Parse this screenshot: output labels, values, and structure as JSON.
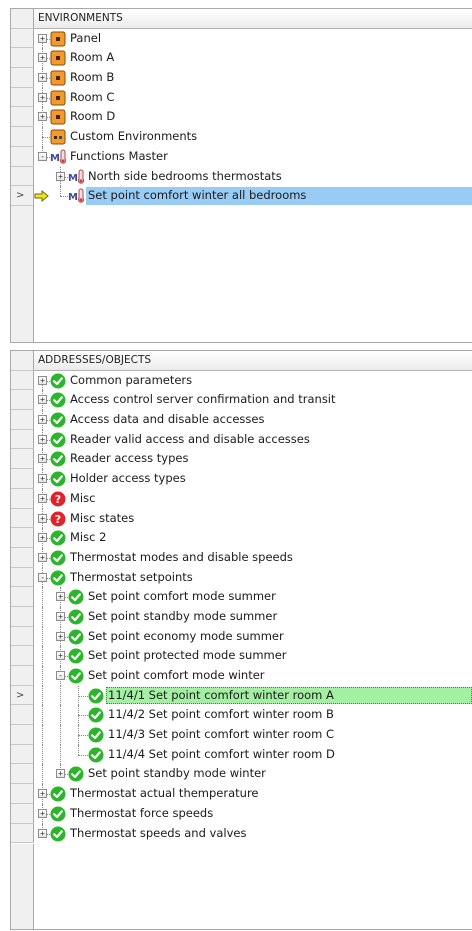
{
  "environments": {
    "header": "ENVIRONMENTS",
    "items": [
      {
        "label": "Panel",
        "icon": "room-icon",
        "expander": "+"
      },
      {
        "label": "Room A",
        "icon": "room-icon",
        "expander": "+"
      },
      {
        "label": "Room B",
        "icon": "room-icon",
        "expander": "+"
      },
      {
        "label": "Room C",
        "icon": "room-icon",
        "expander": "+"
      },
      {
        "label": "Room D",
        "icon": "room-icon",
        "expander": "+"
      },
      {
        "label": "Custom Environments",
        "icon": "custom-environment-icon",
        "expander": ""
      },
      {
        "label": "Functions Master",
        "icon": "functions-master-icon",
        "expander": "-"
      },
      {
        "label": "North side bedrooms thermostats",
        "icon": "function-icon",
        "expander": "+"
      },
      {
        "label": "Set point comfort winter all bedrooms",
        "icon": "function-icon",
        "expander": "",
        "selected": true
      }
    ]
  },
  "objects": {
    "header": "ADDRESSES/OBJECTS",
    "items": [
      {
        "label": "Common parameters",
        "status": "ok"
      },
      {
        "label": "Access control server confirmation and transit",
        "status": "ok"
      },
      {
        "label": "Access data and disable accesses",
        "status": "ok"
      },
      {
        "label": "Reader valid access and disable accesses",
        "status": "ok"
      },
      {
        "label": "Reader access types",
        "status": "ok"
      },
      {
        "label": "Holder access types",
        "status": "ok"
      },
      {
        "label": "Misc",
        "status": "unknown"
      },
      {
        "label": "Misc states",
        "status": "unknown"
      },
      {
        "label": "Misc 2",
        "status": "ok"
      },
      {
        "label": "Thermostat modes and disable speeds",
        "status": "ok"
      },
      {
        "label": "Thermostat setpoints",
        "status": "ok"
      },
      {
        "label": "Set point comfort mode summer",
        "status": "ok"
      },
      {
        "label": "Set point standby mode summer",
        "status": "ok"
      },
      {
        "label": "Set point economy mode summer",
        "status": "ok"
      },
      {
        "label": "Set point protected mode summer",
        "status": "ok"
      },
      {
        "label": "Set point comfort mode winter",
        "status": "ok"
      },
      {
        "label": "11/4/1 Set point comfort winter room A",
        "status": "ok",
        "selected": true
      },
      {
        "label": "11/4/2 Set point comfort winter room B",
        "status": "ok"
      },
      {
        "label": "11/4/3 Set point comfort winter room C",
        "status": "ok"
      },
      {
        "label": "11/4/4 Set point comfort winter room D",
        "status": "ok"
      },
      {
        "label": "Set point standby mode winter",
        "status": "ok"
      },
      {
        "label": "Thermostat actual themperature",
        "status": "ok"
      },
      {
        "label": "Thermostat force speeds",
        "status": "ok"
      },
      {
        "label": "Thermostat speeds and valves",
        "status": "ok"
      }
    ]
  },
  "row_indicator": ">",
  "colors": {
    "selection_blue": "#99ccf5",
    "selection_green": "#a3f0a3",
    "ok_green": "#2bb52b",
    "unknown_red": "#e0222a",
    "room_orange": "#f39a2b"
  }
}
